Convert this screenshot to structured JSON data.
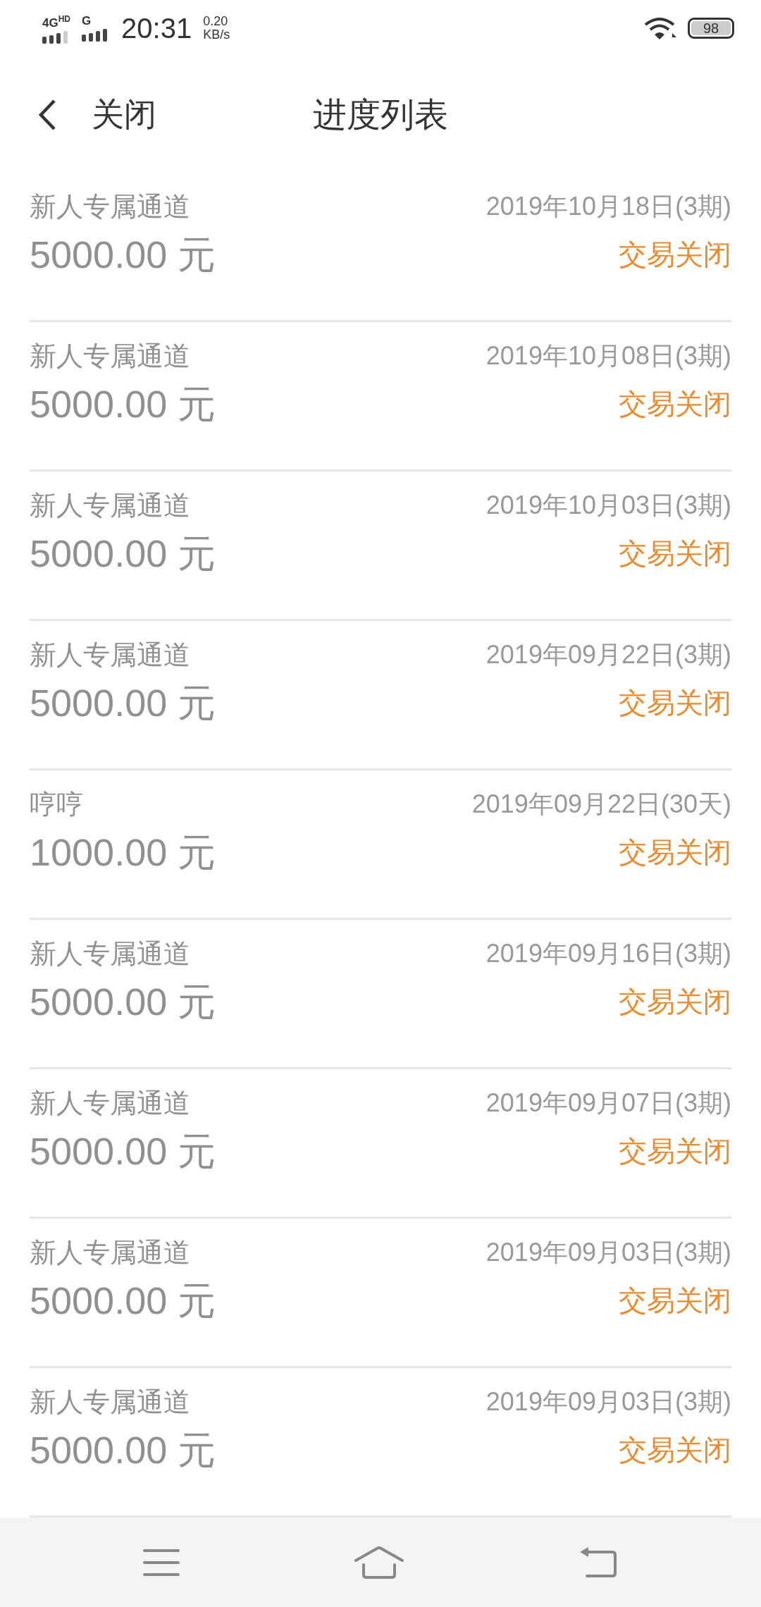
{
  "status_bar": {
    "network_1": "4G",
    "network_1_badge": "HD",
    "network_2": "G",
    "time": "20:31",
    "speed": "0.20",
    "speed_unit": "KB/s",
    "battery": "98"
  },
  "header": {
    "close": "关闭",
    "title": "进度列表"
  },
  "rows": [
    {
      "name": "新人专属通道",
      "amount": "5000.00 元",
      "date": "2019年10月18日(3期)",
      "status": "交易关闭"
    },
    {
      "name": "新人专属通道",
      "amount": "5000.00 元",
      "date": "2019年10月08日(3期)",
      "status": "交易关闭"
    },
    {
      "name": "新人专属通道",
      "amount": "5000.00 元",
      "date": "2019年10月03日(3期)",
      "status": "交易关闭"
    },
    {
      "name": "新人专属通道",
      "amount": "5000.00 元",
      "date": "2019年09月22日(3期)",
      "status": "交易关闭"
    },
    {
      "name": "哼哼",
      "amount": "1000.00 元",
      "date": "2019年09月22日(30天)",
      "status": "交易关闭"
    },
    {
      "name": "新人专属通道",
      "amount": "5000.00 元",
      "date": "2019年09月16日(3期)",
      "status": "交易关闭"
    },
    {
      "name": "新人专属通道",
      "amount": "5000.00 元",
      "date": "2019年09月07日(3期)",
      "status": "交易关闭"
    },
    {
      "name": "新人专属通道",
      "amount": "5000.00 元",
      "date": "2019年09月03日(3期)",
      "status": "交易关闭"
    },
    {
      "name": "新人专属通道",
      "amount": "5000.00 元",
      "date": "2019年09月03日(3期)",
      "status": "交易关闭"
    }
  ]
}
